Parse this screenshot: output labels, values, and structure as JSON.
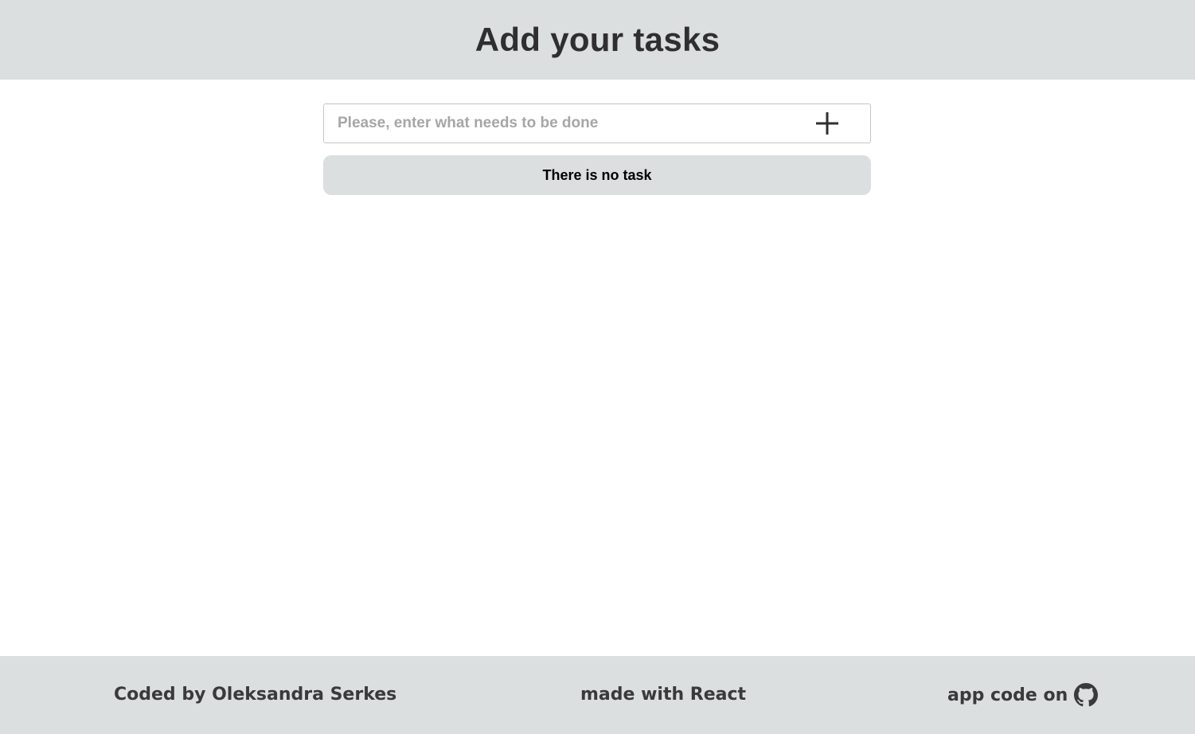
{
  "header": {
    "title": "Add your tasks"
  },
  "task_form": {
    "input_value": "",
    "placeholder": "Please, enter what needs to be done",
    "add_button_icon": "plus-icon"
  },
  "task_list": {
    "empty_message": "There is no task"
  },
  "footer": {
    "credit": "Coded by Oleksandra Serkes",
    "made_with": "made with React",
    "code_label": "app code on",
    "code_icon": "github-icon"
  },
  "colors": {
    "bar_bg": "#dcdfe0",
    "text_dark": "#2f2f2f",
    "placeholder": "#a6a6a6"
  }
}
